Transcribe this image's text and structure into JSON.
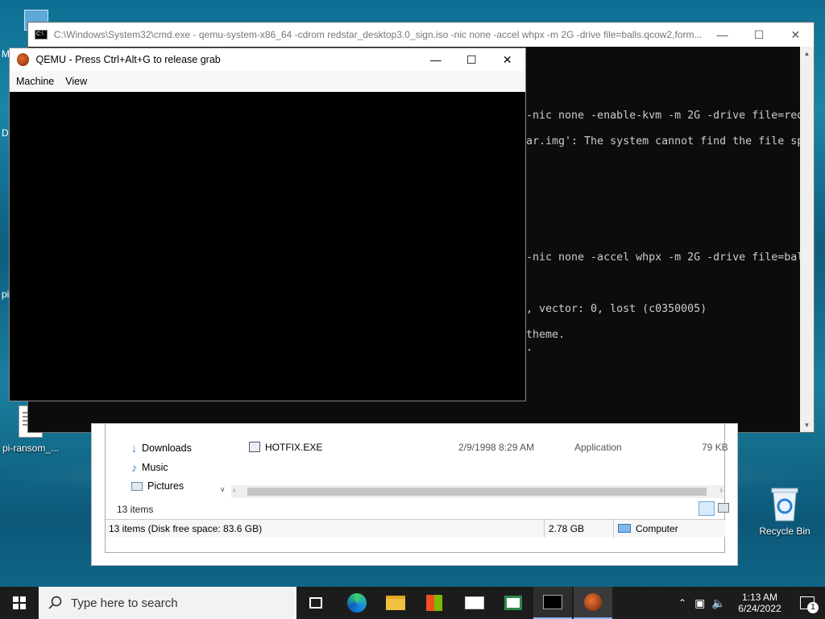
{
  "desktop": {
    "icons": [
      {
        "label": "pi-ransom_..."
      },
      {
        "label": "Recycle Bin"
      }
    ],
    "edge_fragments": [
      "M",
      "D",
      "pi"
    ]
  },
  "cmd": {
    "title": "C:\\Windows\\System32\\cmd.exe - qemu-system-x86_64  -cdrom redstar_desktop3.0_sign.iso -nic none -accel whpx -m 2G -drive file=balls.qcow2,form...",
    "lines": [
      "-nic none -enable-kvm -m 2G -drive file=red",
      "ar.img': The system cannot find the file sp",
      "-nic none -accel whpx -m 2G -drive file=bal",
      ", vector: 0, lost (c0350005)",
      "theme.",
      "."
    ]
  },
  "qemu": {
    "title": "QEMU - Press Ctrl+Alt+G to release grab",
    "menu": [
      "Machine",
      "View"
    ]
  },
  "explorer": {
    "nav": [
      "Downloads",
      "Music",
      "Pictures"
    ],
    "file": {
      "name": "HOTFIX.EXE",
      "date": "2/9/1998 8:29 AM",
      "type": "Application",
      "size": "79 KB"
    },
    "items_count": "13 items",
    "status_left": "13 items (Disk free space: 83.6 GB)",
    "status_size": "2.78 GB",
    "status_location": "Computer"
  },
  "taskbar": {
    "search_placeholder": "Type here to search",
    "time": "1:13 AM",
    "date": "6/24/2022",
    "notification_count": "1"
  }
}
